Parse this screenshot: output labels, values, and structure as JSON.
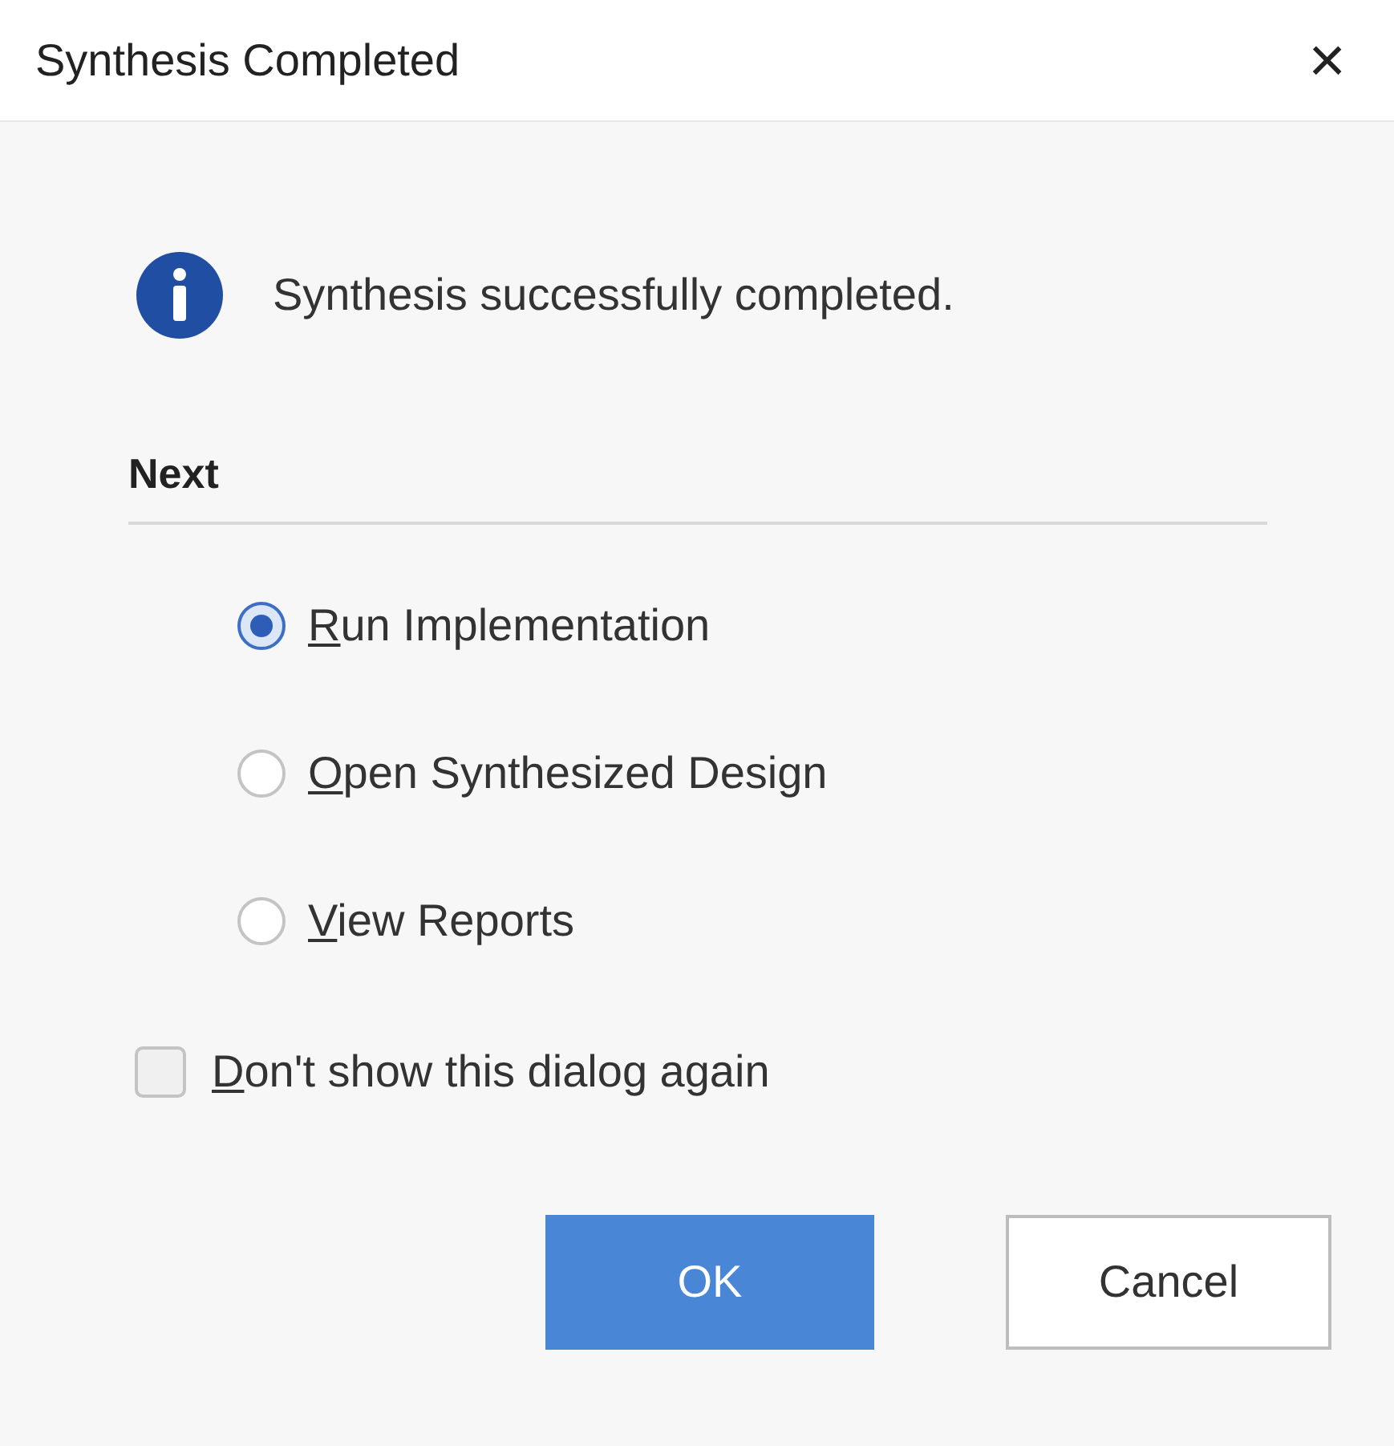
{
  "window": {
    "title": "Synthesis Completed",
    "close": "×"
  },
  "message": "Synthesis successfully completed.",
  "next": {
    "heading": "Next",
    "options": [
      {
        "label": "Run Implementation",
        "selected": true,
        "underline_first": true
      },
      {
        "label": "Open Synthesized Design",
        "selected": false,
        "underline_first": true
      },
      {
        "label": "View Reports",
        "selected": false,
        "underline_first": true
      }
    ]
  },
  "dont_show": {
    "label": "Don't show this dialog again",
    "checked": false,
    "underline_first": true
  },
  "buttons": [
    {
      "label": "OK",
      "kind": "primary"
    },
    {
      "label": "Cancel",
      "kind": "secondary"
    }
  ]
}
